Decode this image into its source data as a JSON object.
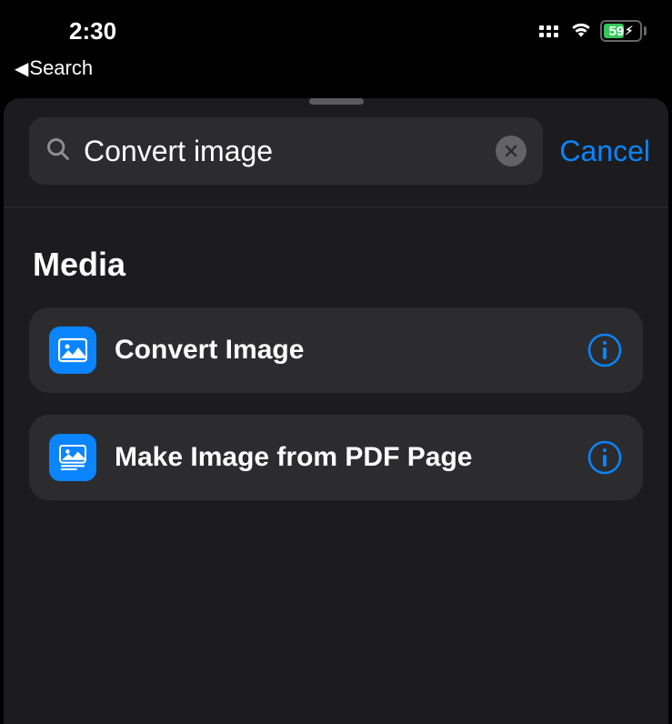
{
  "status": {
    "time": "2:30",
    "back_label": "Search",
    "battery_pct": "59"
  },
  "search": {
    "value": "Convert image",
    "cancel_label": "Cancel"
  },
  "section": {
    "title": "Media"
  },
  "actions": [
    {
      "label": "Convert Image",
      "icon": "photo"
    },
    {
      "label": "Make Image from PDF Page",
      "icon": "photo-pdf"
    }
  ]
}
